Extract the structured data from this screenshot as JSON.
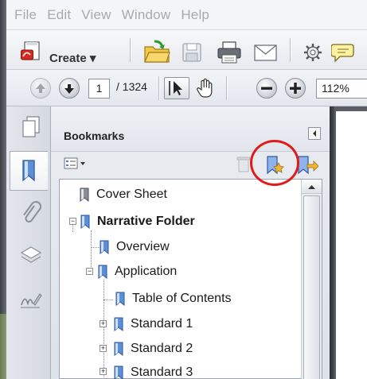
{
  "menu": [
    "File",
    "Edit",
    "View",
    "Window",
    "Help"
  ],
  "toolbar": {
    "create_label": "Create ▾"
  },
  "navigation": {
    "current_page": "1",
    "total_pages": "/ 1324",
    "zoom": "112%"
  },
  "panel": {
    "title": "Bookmarks"
  },
  "bookmarks": [
    {
      "label": "Cover Sheet"
    },
    {
      "label": "Narrative Folder"
    },
    {
      "label": "Overview"
    },
    {
      "label": "Application"
    },
    {
      "label": "Table of Contents"
    },
    {
      "label": "Standard 1"
    },
    {
      "label": "Standard 2"
    },
    {
      "label": "Standard 3"
    }
  ],
  "colors": {
    "highlight": "#e01b1b",
    "bookmark_icon": "#4a7fd1"
  },
  "icons": [
    "create-pdf-icon",
    "open-folder-icon",
    "save-icon",
    "print-icon",
    "email-icon",
    "settings-icon",
    "comment-icon",
    "page-up-icon",
    "page-down-icon",
    "select-tool-icon",
    "hand-tool-icon",
    "zoom-out-icon",
    "zoom-in-icon",
    "pages-icon",
    "bookmark-icon",
    "attachment-icon",
    "layers-icon",
    "signature-icon",
    "options-icon",
    "delete-icon",
    "new-bookmark-icon",
    "bookmark-from-selection-icon"
  ]
}
